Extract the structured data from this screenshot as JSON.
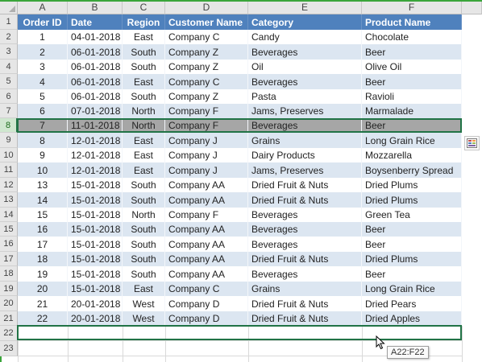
{
  "columns": [
    "A",
    "B",
    "C",
    "D",
    "E",
    "F"
  ],
  "rows": [
    "1",
    "2",
    "3",
    "4",
    "5",
    "6",
    "7",
    "8",
    "9",
    "10",
    "11",
    "12",
    "13",
    "14",
    "15",
    "16",
    "17",
    "18",
    "19",
    "20",
    "21",
    "22",
    "23"
  ],
  "headers": [
    "Order ID",
    "Date",
    "Region",
    "Customer Name",
    "Category",
    "Product Name"
  ],
  "records": [
    [
      "1",
      "04-01-2018",
      "East",
      "Company C",
      "Candy",
      "Chocolate"
    ],
    [
      "2",
      "06-01-2018",
      "South",
      "Company Z",
      "Beverages",
      "Beer"
    ],
    [
      "3",
      "06-01-2018",
      "South",
      "Company Z",
      "Oil",
      "Olive Oil"
    ],
    [
      "4",
      "06-01-2018",
      "East",
      "Company C",
      "Beverages",
      "Beer"
    ],
    [
      "5",
      "06-01-2018",
      "South",
      "Company Z",
      "Pasta",
      "Ravioli"
    ],
    [
      "6",
      "07-01-2018",
      "North",
      "Company F",
      "Jams, Preserves",
      "Marmalade"
    ],
    [
      "7",
      "11-01-2018",
      "North",
      "Company F",
      "Beverages",
      "Beer"
    ],
    [
      "8",
      "12-01-2018",
      "East",
      "Company J",
      "Grains",
      "Long Grain Rice"
    ],
    [
      "9",
      "12-01-2018",
      "East",
      "Company J",
      "Dairy Products",
      "Mozzarella"
    ],
    [
      "10",
      "12-01-2018",
      "East",
      "Company J",
      "Jams, Preserves",
      "Boysenberry Spread"
    ],
    [
      "13",
      "15-01-2018",
      "South",
      "Company AA",
      "Dried Fruit & Nuts",
      "Dried Plums"
    ],
    [
      "14",
      "15-01-2018",
      "South",
      "Company AA",
      "Dried Fruit & Nuts",
      "Dried Plums"
    ],
    [
      "15",
      "15-01-2018",
      "North",
      "Company F",
      "Beverages",
      "Green Tea"
    ],
    [
      "16",
      "15-01-2018",
      "South",
      "Company AA",
      "Beverages",
      "Beer"
    ],
    [
      "17",
      "15-01-2018",
      "South",
      "Company AA",
      "Beverages",
      "Beer"
    ],
    [
      "18",
      "15-01-2018",
      "South",
      "Company AA",
      "Dried Fruit & Nuts",
      "Dried Plums"
    ],
    [
      "19",
      "15-01-2018",
      "South",
      "Company AA",
      "Beverages",
      "Beer"
    ],
    [
      "20",
      "15-01-2018",
      "East",
      "Company C",
      "Grains",
      "Long Grain Rice"
    ],
    [
      "21",
      "20-01-2018",
      "West",
      "Company D",
      "Dried Fruit & Nuts",
      "Dried Pears"
    ],
    [
      "22",
      "20-01-2018",
      "West",
      "Company D",
      "Dried Fruit & Nuts",
      "Dried Apples"
    ]
  ],
  "selected_row_index": 6,
  "range_tooltip": "A22:F22",
  "quick_analysis_icon": "quick-analysis-icon",
  "colors": {
    "header_fill": "#4f81bd",
    "band_fill": "#dce6f1",
    "selected_fill": "#a6a6a6",
    "excel_green": "#217346"
  }
}
